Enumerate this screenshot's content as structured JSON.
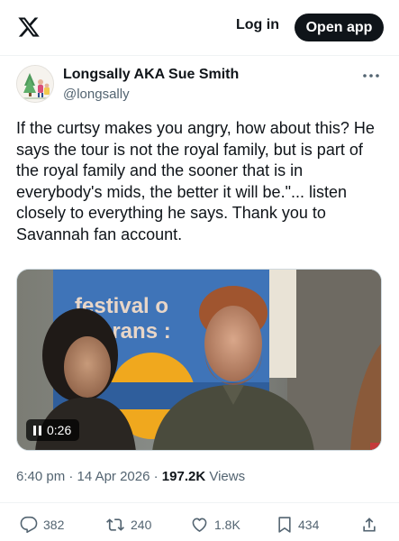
{
  "header": {
    "logo_icon": "x-logo-icon",
    "login_label": "Log in",
    "open_app_label": "Open app"
  },
  "post": {
    "author": {
      "name": "Longsally AKA Sue Smith",
      "handle": "@longsally"
    },
    "text": "If the curtsy makes you angry, how about this? He says the tour is not the royal family, but is part of the royal family and the sooner that is in everybody's mids, the better it will be.\"... listen closely to everything he says. Thank you to Savannah fan account.",
    "media": {
      "type": "video",
      "duration": "0:26",
      "banner_text_line1": "festival o",
      "banner_text_line2": "terans :"
    },
    "meta": {
      "time": "6:40 pm",
      "separator": "·",
      "date": "14 Apr 2026",
      "views_count": "197.2K",
      "views_label": "Views"
    },
    "actions": {
      "replies": "382",
      "reposts": "240",
      "likes": "1.8K",
      "bookmarks": "434"
    }
  },
  "colors": {
    "text_primary": "#0f1419",
    "text_secondary": "#536471",
    "divider": "#eff3f4",
    "button_dark": "#0f1419"
  }
}
